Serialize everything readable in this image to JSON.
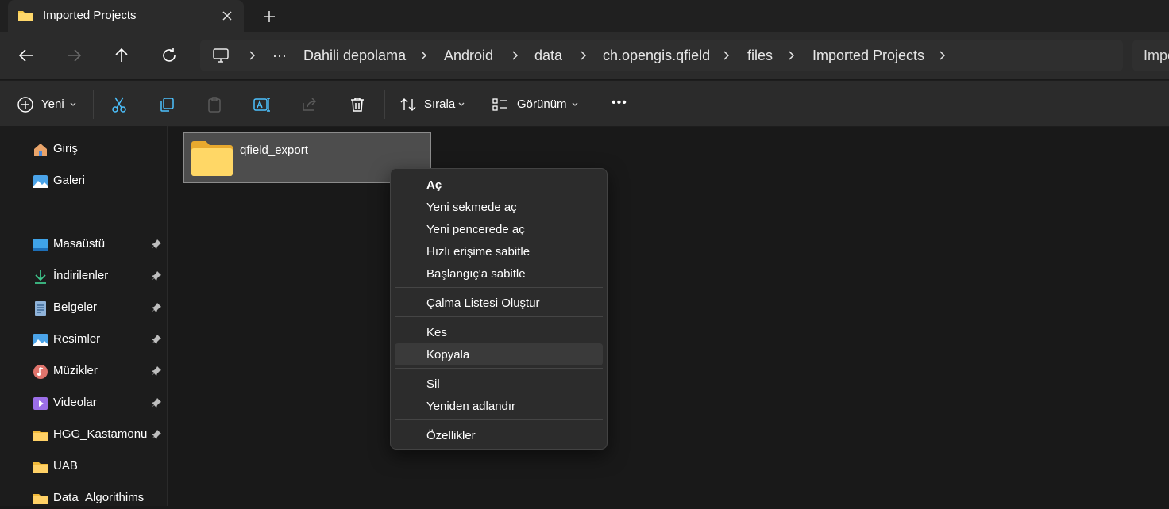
{
  "tab": {
    "title": "Imported Projects"
  },
  "breadcrumb": {
    "items": [
      "Dahili depolama",
      "Android",
      "data",
      "ch.opengis.qfield",
      "files",
      "Imported Projects"
    ],
    "overflow": "···"
  },
  "search": {
    "value": "Impo"
  },
  "toolbar": {
    "new_label": "Yeni",
    "sort_label": "Sırala",
    "view_label": "Görünüm",
    "more_label": "•••"
  },
  "sidebar": {
    "top": [
      {
        "label": "Giriş",
        "icon": "home-icon"
      },
      {
        "label": "Galeri",
        "icon": "gallery-icon"
      }
    ],
    "pinned": [
      {
        "label": "Masaüstü",
        "icon": "desktop-icon"
      },
      {
        "label": "İndirilenler",
        "icon": "download-icon"
      },
      {
        "label": "Belgeler",
        "icon": "document-icon"
      },
      {
        "label": "Resimler",
        "icon": "pictures-icon"
      },
      {
        "label": "Müzikler",
        "icon": "music-icon"
      },
      {
        "label": "Videolar",
        "icon": "video-icon"
      },
      {
        "label": "HGG_Kastamonu",
        "icon": "folder-icon"
      }
    ],
    "folders": [
      {
        "label": "UAB",
        "icon": "folder-icon"
      },
      {
        "label": "Data_Algorithims",
        "icon": "folder-icon"
      }
    ]
  },
  "content": {
    "folders": [
      {
        "name": "qfield_export"
      }
    ]
  },
  "context_menu": {
    "items": [
      {
        "label": "Aç",
        "bold": true
      },
      {
        "label": "Yeni sekmede aç"
      },
      {
        "label": "Yeni pencerede aç"
      },
      {
        "label": "Hızlı erişime sabitle"
      },
      {
        "label": "Başlangıç'a sabitle"
      },
      {
        "label": "Çalma Listesi Oluştur"
      },
      {
        "label": "Kes"
      },
      {
        "label": "Kopyala",
        "highlighted": true
      },
      {
        "label": "Sil"
      },
      {
        "label": "Yeniden adlandır"
      },
      {
        "label": "Özellikler"
      }
    ]
  },
  "colors": {
    "background": "#191919",
    "chrome": "#2b2b2b",
    "folder_yellow": "#f7c948",
    "accent_blue": "#4cc2ff"
  }
}
